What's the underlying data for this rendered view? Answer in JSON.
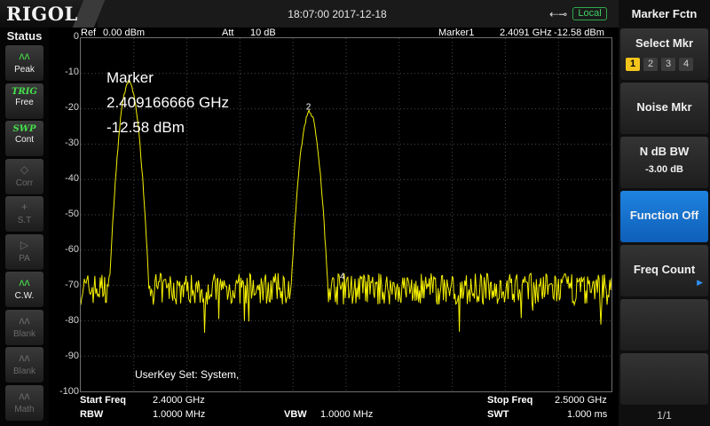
{
  "header": {
    "logo": "RIGOL",
    "datetime": "18:07:00 2017-12-18",
    "usb_icon": "usb-icon",
    "local_badge": "Local"
  },
  "status": {
    "title": "Status",
    "items": [
      {
        "icon": "peak-icon",
        "glyph": "ʌʌ",
        "label": "Peak",
        "state": "active"
      },
      {
        "icon": "trig-icon",
        "glyph": "TRIG",
        "label": "Free",
        "state": "active"
      },
      {
        "icon": "swp-icon",
        "glyph": "SWP",
        "label": "Cont",
        "state": "active"
      },
      {
        "icon": "corr-icon",
        "glyph": "◇",
        "label": "Corr",
        "state": "dim"
      },
      {
        "icon": "st-icon",
        "glyph": "+",
        "label": "S.T",
        "state": "dim"
      },
      {
        "icon": "pa-icon",
        "glyph": "▷",
        "label": "PA",
        "state": "dim"
      },
      {
        "icon": "cw-icon",
        "glyph": "ʌʌ",
        "label": "C.W.",
        "state": "active"
      },
      {
        "icon": "blank-icon",
        "glyph": "ʌʌ",
        "label": "Blank",
        "state": "dim"
      },
      {
        "icon": "blank-icon",
        "glyph": "ʌʌ",
        "label": "Blank",
        "state": "dim"
      },
      {
        "icon": "math-icon",
        "glyph": "ʌʌ",
        "label": "Math",
        "state": "dim"
      }
    ]
  },
  "plot_header": {
    "ref_label": "Ref",
    "ref_value": "0.00 dBm",
    "att_label": "Att",
    "att_value": "10 dB",
    "marker_label": "Marker1",
    "marker_freq": "2.4091 GHz",
    "marker_amp": "-12.58 dBm"
  },
  "marker_readout": {
    "title": "Marker",
    "freq": "2.409166666 GHz",
    "amp": "-12.58 dBm"
  },
  "userkey": "UserKey Set:   System,",
  "footer": {
    "start_label": "Start Freq",
    "start_value": "2.4000 GHz",
    "stop_label": "Stop Freq",
    "stop_value": "2.5000 GHz",
    "rbw_label": "RBW",
    "rbw_value": "1.0000 MHz",
    "vbw_label": "VBW",
    "vbw_value": "1.0000 MHz",
    "swt_label": "SWT",
    "swt_value": "1.000 ms"
  },
  "menu": {
    "title": "Marker Fctn",
    "select_mkr": "Select Mkr",
    "marker_numbers": [
      "1",
      "2",
      "3",
      "4"
    ],
    "selected_marker": "1",
    "noise_mkr": "Noise Mkr",
    "ndb_bw": "N dB BW",
    "ndb_value": "-3.00 dB",
    "function_off": "Function Off",
    "freq_count": "Freq Count",
    "page": "1/1"
  },
  "chart_data": {
    "type": "line",
    "x_unit": "GHz",
    "y_unit": "dBm",
    "xlim": [
      2.4,
      2.5
    ],
    "ylim": [
      -100,
      0
    ],
    "y_ticks": [
      "0",
      "-10",
      "-20",
      "-30",
      "-40",
      "-50",
      "-60",
      "-70",
      "-80",
      "-90",
      "-100"
    ],
    "grid": true,
    "trace_color": "#f5f000",
    "noise_floor": -71,
    "peaks": [
      {
        "x": 2.4091,
        "y": -12.58,
        "label": "1"
      },
      {
        "x": 2.4431,
        "y": -21,
        "label": "2"
      }
    ],
    "markers": [
      {
        "label": "2",
        "x": 2.4431,
        "y": -21
      },
      {
        "label": "4",
        "x": 2.4495,
        "y": -69
      }
    ]
  }
}
